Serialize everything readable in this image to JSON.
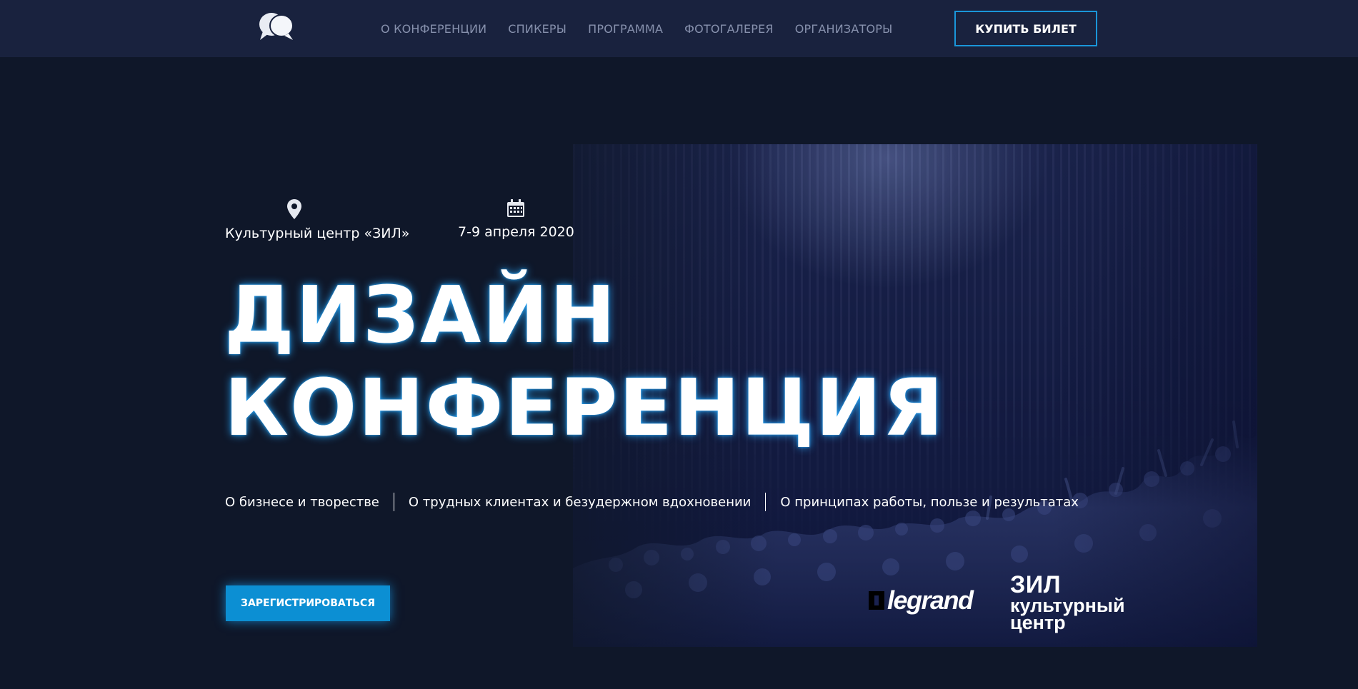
{
  "nav": {
    "items": [
      {
        "label": "О КОНФЕРЕНЦИИ"
      },
      {
        "label": "СПИКЕРЫ"
      },
      {
        "label": "ПРОГРАММА"
      },
      {
        "label": "ФОТОГАЛЕРЕЯ"
      },
      {
        "label": "ОРГАНИЗАТОРЫ"
      }
    ],
    "buy_label": "КУПИТЬ БИЛЕТ",
    "logo_icon": "speech-bubbles-icon"
  },
  "hero": {
    "location": {
      "icon": "map-pin-icon",
      "text": "Культурный центр «ЗИЛ»"
    },
    "date": {
      "icon": "calendar-icon",
      "text": "7-9 апреля 2020"
    },
    "title_line1": "ДИЗАЙН",
    "title_line2": "КОНФЕРЕНЦИЯ",
    "topics": [
      "О бизнесе и творестве",
      "О трудных клиентах и безудержном вдохновении",
      "О принципах работы, пользе и результатах"
    ],
    "register_label": "ЗАРЕГИСТРИРОВАТЬСЯ"
  },
  "sponsors": {
    "legrand": "legrand",
    "zil_line1": "ЗИЛ",
    "zil_line2": "культурный",
    "zil_line3": "центр"
  },
  "colors": {
    "background": "#0f1729",
    "navbar": "#19223e",
    "accent": "#1a96d9",
    "nav_text": "#8791ad"
  }
}
